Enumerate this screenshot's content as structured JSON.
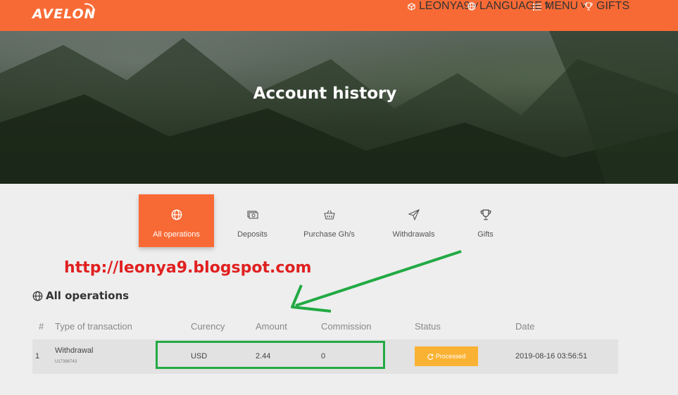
{
  "brand": {
    "logo": "AVELON"
  },
  "nav": [
    {
      "label": "LEONYA9",
      "icon": "cube-icon",
      "caret": "˅"
    },
    {
      "label": "LANGUAGE",
      "icon": "globe-icon",
      "caret": "˅"
    },
    {
      "label": "MENU",
      "icon": "list-icon",
      "caret": "˅"
    },
    {
      "label": "GIFTS",
      "icon": "trophy-icon"
    }
  ],
  "hero": {
    "title": "Account history"
  },
  "tabs": [
    {
      "label": "All operations",
      "icon": "globe-icon",
      "active": true
    },
    {
      "label": "Deposits",
      "icon": "money-icon"
    },
    {
      "label": "Purchase Gh/s",
      "icon": "basket-icon"
    },
    {
      "label": "Withdrawals",
      "icon": "paper-plane-icon"
    },
    {
      "label": "Gifts",
      "icon": "trophy-icon"
    }
  ],
  "annotation": {
    "link": "http://leonya9.blogspot.com",
    "highlight_color": "#22aa44",
    "link_color": "#e02020"
  },
  "section": {
    "title": "All operations"
  },
  "table": {
    "headers": [
      "#",
      "Type of transaction",
      "Curency",
      "Amount",
      "Commission",
      "Status",
      "Date"
    ],
    "rows": [
      {
        "num": "1",
        "type": "Withdrawal",
        "sub": "U17386743",
        "currency": "USD",
        "amount": "2.44",
        "commission": "0",
        "status": "Processed",
        "date": "2019-08-16 03:56:51"
      }
    ]
  },
  "colors": {
    "accent": "#f86a35",
    "status_processed": "#f9b233"
  }
}
